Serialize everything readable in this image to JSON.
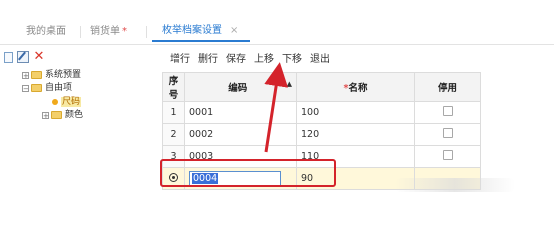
{
  "tabs": {
    "home": "我的桌面",
    "sales": "销货单",
    "sales_modified": "*",
    "active": "枚举档案设置",
    "close_glyph": "×"
  },
  "tree": {
    "toolbar": {
      "new_icon": "new-doc-icon",
      "edit_icon": "edit-icon",
      "delete_glyph": "✕"
    },
    "nodes": [
      {
        "label": "系统预置",
        "expander": "+"
      },
      {
        "label": "自由项",
        "expander": "−"
      },
      {
        "label": "尺码"
      },
      {
        "label": "颜色",
        "expander": "+"
      }
    ]
  },
  "actions": {
    "add_row": "增行",
    "delete_row": "删行",
    "save": "保存",
    "move_up": "上移",
    "move_down": "下移",
    "exit": "退出"
  },
  "grid": {
    "headers": {
      "seq": "序号",
      "code": "编码",
      "name_required_mark": "*",
      "name": "名称",
      "disabled": "停用"
    },
    "rows": [
      {
        "seq": "1",
        "code": "0001",
        "name": "100"
      },
      {
        "seq": "2",
        "code": "0002",
        "name": "120"
      },
      {
        "seq": "3",
        "code": "0003",
        "name": "110"
      }
    ],
    "editing_row": {
      "code": "0004",
      "name": "90"
    }
  },
  "colors": {
    "accent": "#2a7bd1",
    "annotation_red": "#d4232b"
  }
}
